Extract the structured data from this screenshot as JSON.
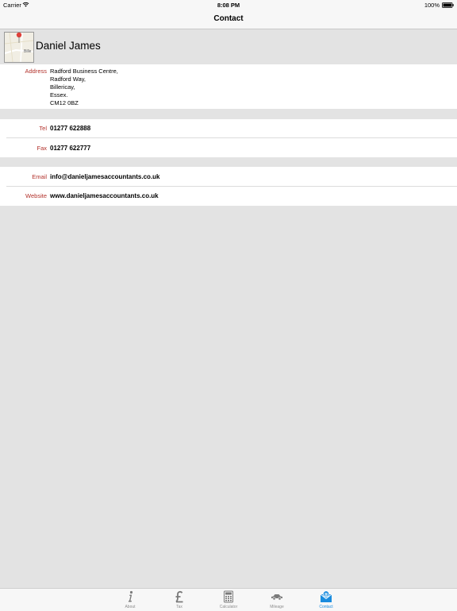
{
  "status": {
    "carrier": "Carrier",
    "time": "8:08 PM",
    "battery": "100%"
  },
  "nav": {
    "title": "Contact"
  },
  "header": {
    "name": "Daniel James",
    "map_text": "Bille"
  },
  "address": {
    "label": "Address",
    "lines": [
      "Radford Business Centre,",
      "Radford Way,",
      "Billericay,",
      "Essex.",
      "CM12 0BZ"
    ]
  },
  "phone": {
    "tel_label": "Tel",
    "tel": "01277 622888",
    "fax_label": "Fax",
    "fax": "01277 622777"
  },
  "online": {
    "email_label": "Email",
    "email": "info@danieljamesaccountants.co.uk",
    "website_label": "Website",
    "website": "www.danieljamesaccountants.co.uk"
  },
  "tabs": [
    {
      "label": "About",
      "icon": "info-icon"
    },
    {
      "label": "Tax",
      "icon": "pound-icon"
    },
    {
      "label": "Calculator",
      "icon": "calculator-icon"
    },
    {
      "label": "Mileage",
      "icon": "car-icon"
    },
    {
      "label": "Contact",
      "icon": "contact-icon",
      "active": true
    }
  ],
  "colors": {
    "label": "#b2312b",
    "active_tab": "#1a8cde",
    "background": "#e3e3e3"
  }
}
